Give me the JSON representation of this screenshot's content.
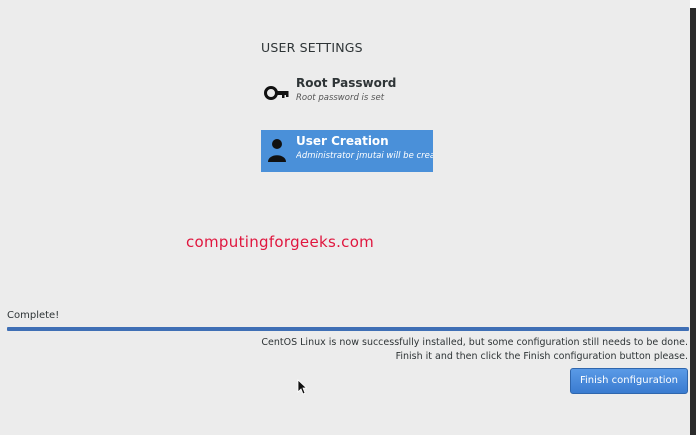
{
  "user_settings": {
    "section_title": "USER SETTINGS",
    "spokes": [
      {
        "title": "Root Password",
        "status": "Root password is set",
        "icon": "key-icon",
        "selected": false
      },
      {
        "title": "User Creation",
        "status": "Administrator jmutai will be created",
        "icon": "user-icon",
        "selected": true
      }
    ]
  },
  "watermark": "computingforgeeks.com",
  "progress": {
    "label": "Complete!",
    "value_percent": 100
  },
  "message": {
    "line1": "CentOS Linux is now successfully installed, but some configuration still needs to be done.",
    "line2": "Finish it and then click the Finish configuration button please."
  },
  "buttons": {
    "finish_label": "Finish configuration"
  },
  "colors": {
    "selected_spoke": "#4a90d9",
    "progress_fill": "#3f6fb5",
    "watermark": "#e0163e",
    "background": "#ececec"
  }
}
